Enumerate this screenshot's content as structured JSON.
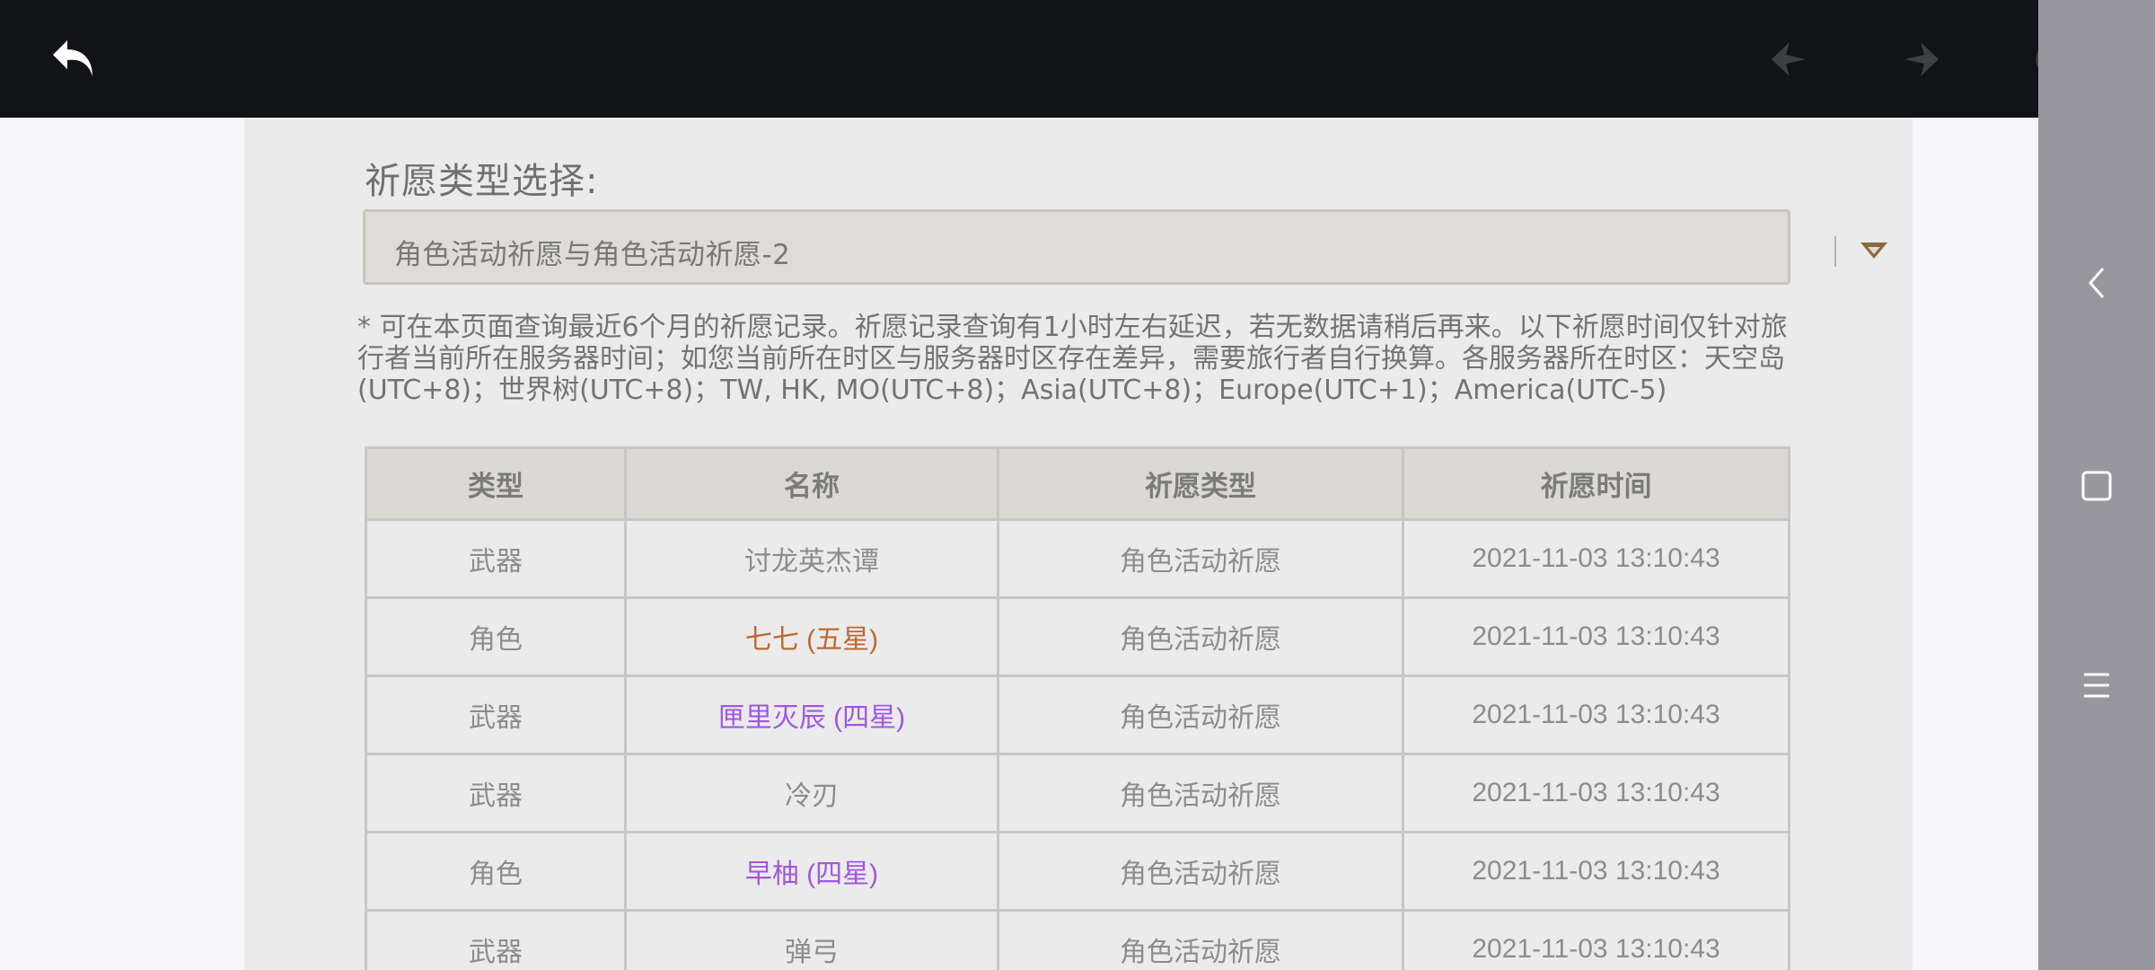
{
  "top_bar": {
    "icons": {
      "back": "back-arrow-icon",
      "prev": "nav-prev-icon",
      "next": "nav-next-icon",
      "reload": "reload-icon"
    }
  },
  "side_bar": {
    "icons": {
      "back": "chevron-left-icon",
      "home": "square-icon",
      "menu": "menu-lines-icon"
    }
  },
  "gacha_type": {
    "label": "祈愿类型选择:",
    "selected": "角色活动祈愿与角色活动祈愿-2"
  },
  "note": "* 可在本页面查询最近6个月的祈愿记录。祈愿记录查询有1小时左右延迟，若无数据请稍后再来。以下祈愿时间仅针对旅行者当前所在服务器时间；如您当前所在时区与服务器时区存在差异，需要旅行者自行换算。各服务器所在时区：天空岛(UTC+8)；世界树(UTC+8)；TW, HK, MO(UTC+8)；Asia(UTC+8)；Europe(UTC+1)；America(UTC-5)",
  "table": {
    "headers": [
      "类型",
      "名称",
      "祈愿类型",
      "祈愿时间"
    ],
    "rows": [
      {
        "type": "武器",
        "name": "讨龙英杰谭",
        "gacha": "角色活动祈愿",
        "time": "2021-11-03 13:10:43",
        "rarity": "normal"
      },
      {
        "type": "角色",
        "name": "七七 (五星)",
        "gacha": "角色活动祈愿",
        "time": "2021-11-03 13:10:43",
        "rarity": "five"
      },
      {
        "type": "武器",
        "name": "匣里灭辰 (四星)",
        "gacha": "角色活动祈愿",
        "time": "2021-11-03 13:10:43",
        "rarity": "four"
      },
      {
        "type": "武器",
        "name": "冷刃",
        "gacha": "角色活动祈愿",
        "time": "2021-11-03 13:10:43",
        "rarity": "normal"
      },
      {
        "type": "角色",
        "name": "早柚 (四星)",
        "gacha": "角色活动祈愿",
        "time": "2021-11-03 13:10:43",
        "rarity": "four"
      },
      {
        "type": "武器",
        "name": "弹弓",
        "gacha": "角色活动祈愿",
        "time": "2021-11-03 13:10:43",
        "rarity": "normal"
      }
    ]
  },
  "colors": {
    "five_star": "#bd6932",
    "four_star": "#a256e1",
    "normal": "#8c8c8c"
  }
}
